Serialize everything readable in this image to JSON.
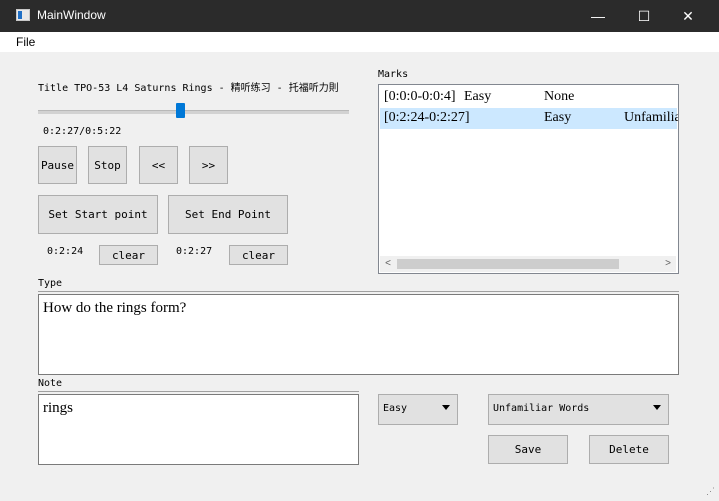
{
  "window": {
    "title": "MainWindow",
    "controls": {
      "minimize": "—",
      "maximize": "☐",
      "close": "✕"
    }
  },
  "menu": {
    "file": "File"
  },
  "player": {
    "title": "Title TPO-53 L4 Saturns Rings - 精听练习 - 托福听力則",
    "slider_value": 0.41,
    "time": "0:2:27/0:5:22",
    "pause_label": "Pause",
    "stop_label": "Stop",
    "rewind_label": "<<",
    "forward_label": ">>",
    "set_start_label": "Set Start point",
    "set_end_label": "Set End Point",
    "start_time": "0:2:24",
    "end_time": "0:2:27",
    "clear_label": "clear"
  },
  "marks": {
    "label": "Marks",
    "rows": [
      {
        "range": "[0:0:0-0:0:4]",
        "difficulty": "Easy",
        "type": "None",
        "selected": false
      },
      {
        "range": "[0:2:24-0:2:27]",
        "difficulty": "Easy",
        "type": "Unfamilia",
        "selected": true
      }
    ]
  },
  "type_section": {
    "label": "Type",
    "value": "How do the rings form?"
  },
  "note_section": {
    "label": "Note",
    "value": "rings"
  },
  "difficulty_select": {
    "value": "Easy"
  },
  "category_select": {
    "value": "Unfamiliar Words"
  },
  "actions": {
    "save_label": "Save",
    "delete_label": "Delete"
  },
  "colors": {
    "selection": "#cce8ff",
    "accent": "#0078d7",
    "titlebar": "#2b2b2b"
  }
}
